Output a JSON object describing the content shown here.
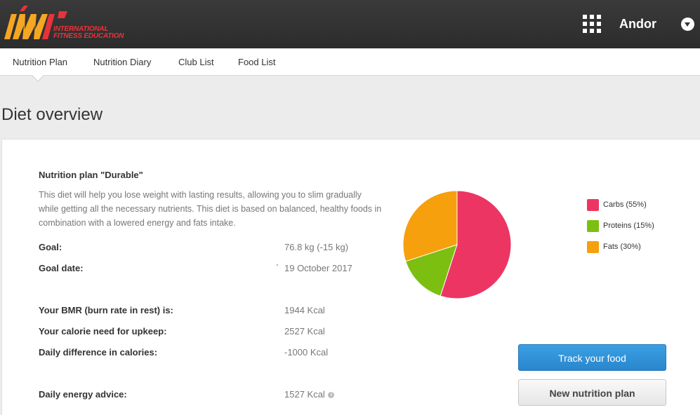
{
  "brand": {
    "logo_text": "IWI",
    "tagline_line1": "INTERNATIONAL",
    "tagline_line2": "FITNESS EDUCATION",
    "accent_color": "#f5a623",
    "red_color": "#e8333a"
  },
  "header": {
    "apps_icon": "grid-icon",
    "username": "Andor",
    "dropdown_icon": "chevron-down-icon"
  },
  "nav": {
    "items": [
      {
        "label": "Nutrition Plan",
        "active": true
      },
      {
        "label": "Nutrition Diary"
      },
      {
        "label": "Club List"
      },
      {
        "label": "Food List"
      }
    ]
  },
  "page": {
    "title": "Diet overview"
  },
  "plan": {
    "title": "Nutrition plan \"Durable\"",
    "description": "This diet will help you lose weight with lasting results, allowing you to slim gradually while getting all the necessary nutrients. This diet is based on balanced, healthy foods in combination with a lowered energy and fats intake.",
    "rows": [
      {
        "label": "Goal:",
        "value": "76.8 kg (-15 kg)"
      },
      {
        "label": "Goal date:",
        "value": "19 October 2017"
      },
      {
        "label": "Your BMR (burn rate in rest) is:",
        "value": "1944 Kcal"
      },
      {
        "label": "Your calorie need for upkeep:",
        "value": "2527 Kcal"
      },
      {
        "label": "Daily difference in calories:",
        "value": "-1000 Kcal"
      },
      {
        "label": "Daily energy advice:",
        "value": "1527 Kcal"
      }
    ],
    "required_mark": "'"
  },
  "chart_data": {
    "type": "pie",
    "slices": [
      {
        "label": "Carbs (55%)",
        "value": 55,
        "color": "#ec3563"
      },
      {
        "label": "Proteins (15%)",
        "value": 15,
        "color": "#7cbf10"
      },
      {
        "label": "Fats (30%)",
        "value": 30,
        "color": "#f5a00c"
      }
    ],
    "legend_position": "right"
  },
  "actions": {
    "track_label": "Track your food",
    "new_plan_label": "New nutrition plan",
    "primary_color": "#3b9fe2"
  }
}
